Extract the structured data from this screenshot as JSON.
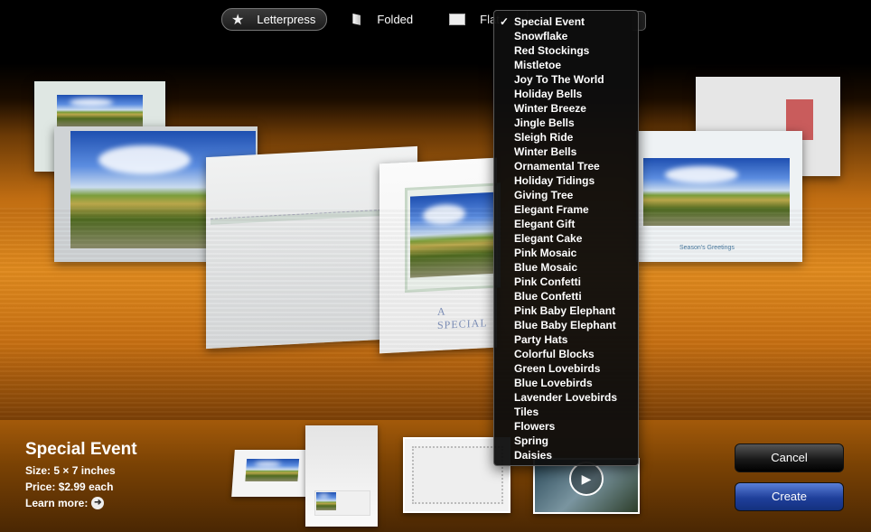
{
  "toolbar": {
    "letterpress_label": "Letterpress",
    "folded_label": "Folded",
    "flat_label": "Flat"
  },
  "theme_menu": {
    "items": [
      "Special Event",
      "Snowflake",
      "Red Stockings",
      "Mistletoe",
      "Joy To The World",
      "Holiday Bells",
      "Winter Breeze",
      "Jingle Bells",
      "Sleigh Ride",
      "Winter Bells",
      "Ornamental Tree",
      "Holiday Tidings",
      "Giving Tree",
      "Elegant Frame",
      "Elegant Gift",
      "Elegant Cake",
      "Pink Mosaic",
      "Blue Mosaic",
      "Pink Confetti",
      "Blue Confetti",
      "Pink Baby Elephant",
      "Blue Baby Elephant",
      "Party Hats",
      "Colorful Blocks",
      "Green Lovebirds",
      "Blue Lovebirds",
      "Lavender Lovebirds",
      "Tiles",
      "Flowers",
      "Spring",
      "Daisies"
    ],
    "checked_index": 0,
    "check_glyph": "✓"
  },
  "cards": {
    "center_text": "A SPECIAL",
    "right_text": "Season's Greetings"
  },
  "info": {
    "title": "Special Event",
    "size_label": "Size:",
    "size_value": "5 × 7 inches",
    "price_label": "Price:",
    "price_value": "$2.99 each",
    "learn_more": "Learn more:"
  },
  "buttons": {
    "cancel": "Cancel",
    "create": "Create"
  },
  "colors": {
    "stage_orange": "#e08a1e",
    "create_blue": "#1f3f9a"
  }
}
